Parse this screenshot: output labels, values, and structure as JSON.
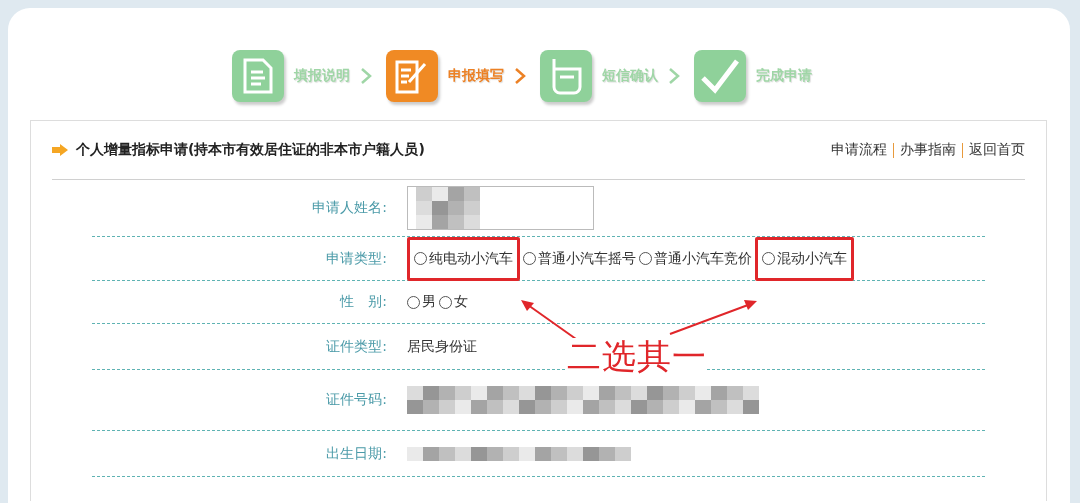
{
  "steps": [
    {
      "label": "填报说明",
      "kind": "document",
      "selected": false
    },
    {
      "label": "申报填写",
      "kind": "edit",
      "selected": true
    },
    {
      "label": "短信确认",
      "kind": "phone",
      "selected": false
    },
    {
      "label": "完成申请",
      "kind": "check",
      "selected": false
    }
  ],
  "panel": {
    "title": "个人增量指标申请(持本市有效居住证的非本市户籍人员)",
    "links": [
      "申请流程",
      "办事指南",
      "返回首页"
    ]
  },
  "form": [
    {
      "label": "申请人姓名:",
      "kind": "input"
    },
    {
      "label": "申请类型:",
      "kind": "radios",
      "options": [
        {
          "label": "纯电动小汽车",
          "selected": false,
          "highlighted": true
        },
        {
          "label": "普通小汽车摇号",
          "selected": false,
          "highlighted": false
        },
        {
          "label": "普通小汽车竞价",
          "selected": false,
          "highlighted": false
        },
        {
          "label": "混动小汽车",
          "selected": false,
          "highlighted": true
        }
      ]
    },
    {
      "label": "性　别:",
      "kind": "radios",
      "options": [
        {
          "label": "男",
          "selected": false,
          "highlighted": false
        },
        {
          "label": "女",
          "selected": false,
          "highlighted": false
        }
      ]
    },
    {
      "label": "证件类型:",
      "kind": "text",
      "value": "居民身份证"
    },
    {
      "label": "证件号码:",
      "kind": "redacted-input"
    },
    {
      "label": "出生日期:",
      "kind": "redacted"
    }
  ],
  "annotation": {
    "text": "二选其一"
  }
}
